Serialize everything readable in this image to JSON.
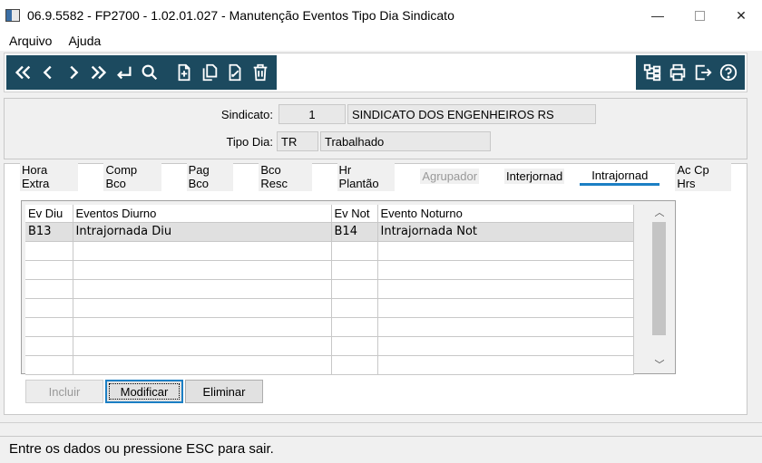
{
  "window": {
    "title": "06.9.5582 - FP2700 - 1.02.01.027 - Manutenção Eventos Tipo Dia Sindicato",
    "minimize": "—",
    "close": "✕"
  },
  "menu": {
    "items": [
      "Arquivo",
      "Ajuda"
    ]
  },
  "toolbar": {
    "left_icons": [
      "first-icon",
      "previous-icon",
      "next-icon",
      "last-icon",
      "enter-icon",
      "search-icon",
      "new-icon",
      "copy-icon",
      "edit-icon",
      "delete-icon"
    ],
    "right_icons": [
      "structure-icon",
      "print-icon",
      "exit-icon",
      "help-icon"
    ],
    "bg_color": "#1c4a5f"
  },
  "header": {
    "sindicato_label": "Sindicato:",
    "sindicato_code": "1",
    "sindicato_name": "SINDICATO DOS ENGENHEIROS RS",
    "tipo_dia_label": "Tipo Dia:",
    "tipo_dia_code": "TR",
    "tipo_dia_name": "Trabalhado"
  },
  "tabs": [
    {
      "label": "Hora Extra",
      "state": "normal"
    },
    {
      "label": "Comp Bco",
      "state": "normal"
    },
    {
      "label": "Pag Bco",
      "state": "normal"
    },
    {
      "label": "Bco Resc",
      "state": "normal"
    },
    {
      "label": "Hr Plantão",
      "state": "normal"
    },
    {
      "label": "Agrupador",
      "state": "disabled"
    },
    {
      "label": "Interjornad",
      "state": "normal"
    },
    {
      "label": "Intrajornad",
      "state": "active"
    },
    {
      "label": "Ac Cp Hrs",
      "state": "normal"
    }
  ],
  "grid": {
    "columns": [
      "Ev Diu",
      "Eventos Diurno",
      "Ev Not",
      "Evento Noturno"
    ],
    "rows": [
      [
        "B13",
        "Intrajornada Diu",
        "B14",
        "Intrajornada Not"
      ],
      [
        "",
        "",
        "",
        ""
      ],
      [
        "",
        "",
        "",
        ""
      ],
      [
        "",
        "",
        "",
        ""
      ],
      [
        "",
        "",
        "",
        ""
      ],
      [
        "",
        "",
        "",
        ""
      ],
      [
        "",
        "",
        "",
        ""
      ],
      [
        "",
        "",
        "",
        ""
      ]
    ]
  },
  "buttons": {
    "incluir": "Incluir",
    "modificar": "Modificar",
    "eliminar": "Eliminar"
  },
  "status": {
    "text": "Entre os dados ou pressione ESC para sair."
  },
  "accent_color": "#1c7fc4"
}
